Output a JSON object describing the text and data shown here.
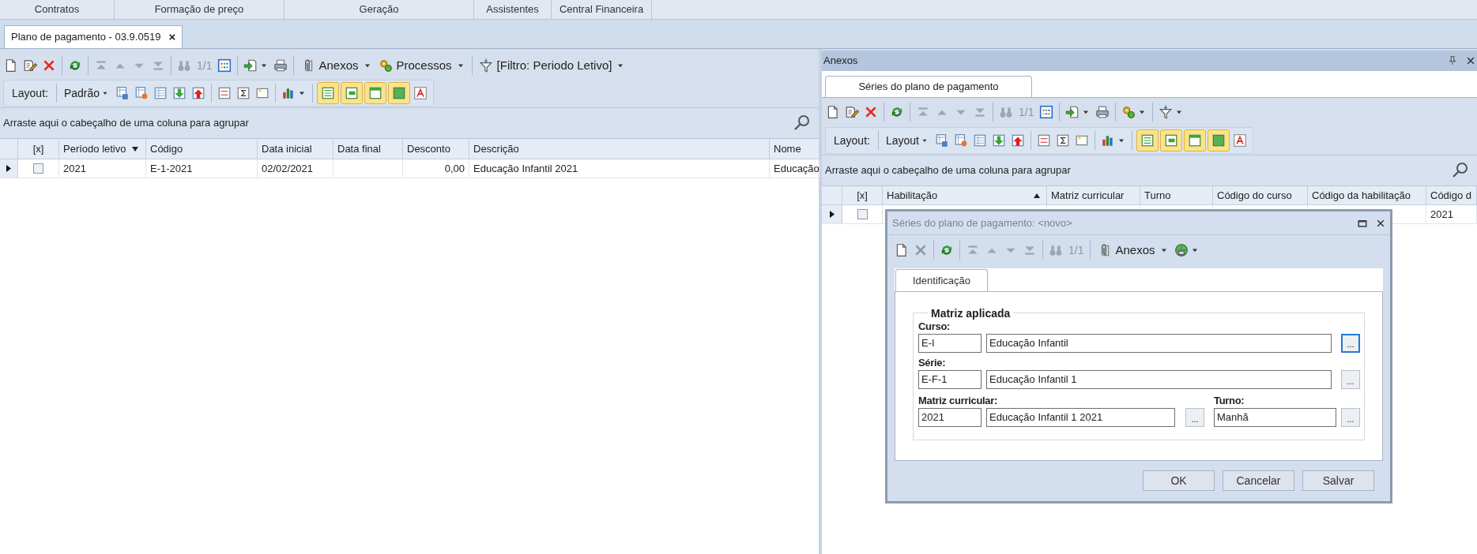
{
  "menu_bar": {
    "items": [
      "Contratos",
      "Formação de preço",
      "Geração",
      "Assistentes",
      "Central Financeira"
    ]
  },
  "document_tabs": [
    {
      "label": "Plano de pagamento - 03.9.0519",
      "selected": true,
      "close": "×"
    }
  ],
  "main": {
    "toolbar": {
      "counter": "1/1",
      "attachments": "Anexos",
      "processes": "Processos",
      "filter": "[Filtro: Periodo Letivo]"
    },
    "layout_bar": {
      "label": "Layout:",
      "preset": "Padrão",
      "toggles": [
        {
          "on": true
        },
        {
          "on": true
        },
        {
          "on": true
        },
        {
          "on": true
        }
      ]
    },
    "group_panel": "Arraste aqui o cabeçalho de uma coluna para agrupar",
    "grid": {
      "columns": [
        {
          "label": "[x]"
        },
        {
          "label": "Período letivo",
          "sort_ascending": false
        },
        {
          "label": "Código"
        },
        {
          "label": "Data inicial"
        },
        {
          "label": "Data final"
        },
        {
          "label": "Desconto",
          "kind": "number"
        },
        {
          "label": "Descrição"
        },
        {
          "label": "Nome"
        }
      ],
      "rows": [
        {
          "current": true,
          "checked": false,
          "cells": [
            "",
            "2021",
            "E-1-2021",
            "02/02/2021",
            "",
            "0,00",
            "Educação Infantil 2021",
            "Educação"
          ]
        }
      ]
    }
  },
  "side_panel": {
    "title": "Anexos",
    "tabs": [
      {
        "label": "Séries do plano de pagamento",
        "selected": true
      }
    ],
    "toolbar": {
      "counter": "1/1"
    },
    "layout_bar": {
      "label": "Layout:",
      "preset": "Layout",
      "toggles": [
        {
          "on": true
        },
        {
          "on": true
        },
        {
          "on": true
        },
        {
          "on": true
        }
      ]
    },
    "group_panel": "Arraste aqui o cabeçalho de uma coluna para agrupar",
    "grid": {
      "columns": [
        {
          "label": "[x]"
        },
        {
          "label": "Habilitação",
          "sort_ascending": true
        },
        {
          "label": "Matriz curricular"
        },
        {
          "label": "Turno"
        },
        {
          "label": "Código do curso"
        },
        {
          "label": "Código da habilitação"
        },
        {
          "label": "Código d"
        }
      ],
      "rows": [
        {
          "current": true,
          "checked": false,
          "cells": [
            "",
            "",
            "",
            "",
            "",
            "",
            "2021"
          ]
        }
      ]
    }
  },
  "dialog": {
    "title": "Séries do plano de pagamento: <novo>",
    "toolbar": {
      "counter": "1/1",
      "attachments": "Anexos"
    },
    "tabs": [
      {
        "label": "Identificação",
        "selected": true
      }
    ],
    "group": {
      "title": "Matriz aplicada",
      "rows": [
        {
          "kind": "wide",
          "label": "Curso:",
          "code": "E-I",
          "name": "Educação Infantil",
          "lookup": "...",
          "focused": true
        },
        {
          "kind": "wide",
          "label": "Série:",
          "code": "E-F-1",
          "name": "Educação Infantil 1",
          "lookup": "...",
          "focused": false
        },
        {
          "kind": "split",
          "label": "Matriz curricular:",
          "code": "2021",
          "name": "Educação Infantil 1 2021",
          "lookup": "...",
          "focused": false,
          "second": {
            "label": "Turno:",
            "value": "Manhã",
            "lookup": "...",
            "focused": false
          }
        }
      ]
    },
    "buttons": [
      "OK",
      "Cancelar",
      "Salvar"
    ]
  }
}
